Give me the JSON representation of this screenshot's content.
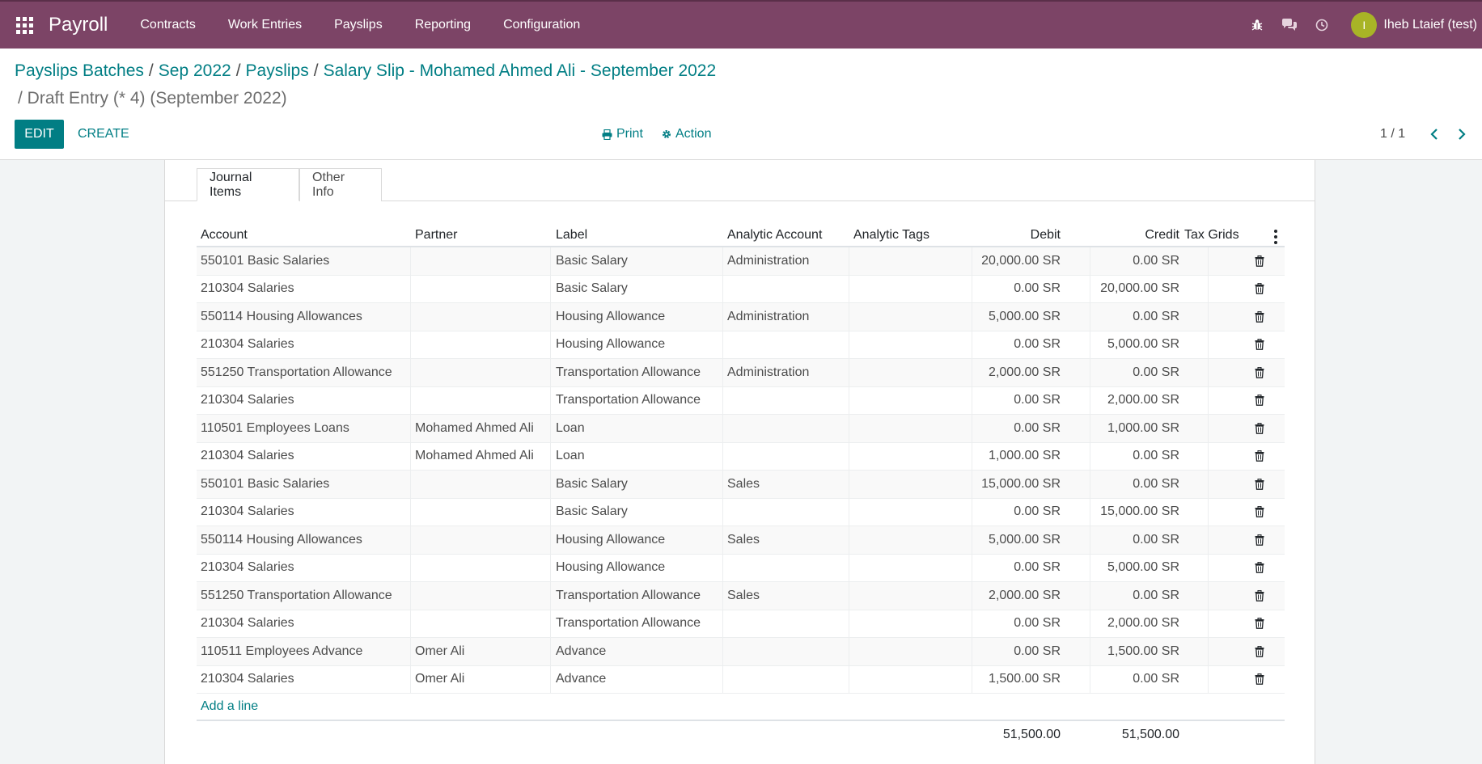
{
  "navbar": {
    "brand": "Payroll",
    "menu": [
      "Contracts",
      "Work Entries",
      "Payslips",
      "Reporting",
      "Configuration"
    ],
    "user_initial": "I",
    "username": "Iheb Ltaief (test)"
  },
  "breadcrumb": {
    "items": [
      "Payslips Batches",
      "Sep 2022",
      "Payslips",
      "Salary Slip - Mohamed Ahmed Ali - September 2022"
    ],
    "current": "/ Draft Entry (* 4) (September 2022)"
  },
  "buttons": {
    "edit": "EDIT",
    "create": "CREATE",
    "print": "Print",
    "action": "Action"
  },
  "pager": {
    "value": "1 / 1"
  },
  "tabs": [
    "Journal Items",
    "Other Info"
  ],
  "table": {
    "headers": {
      "account": "Account",
      "partner": "Partner",
      "label": "Label",
      "analytic": "Analytic Account",
      "tags": "Analytic Tags",
      "debit": "Debit",
      "credit": "Credit",
      "tax": "Tax Grids"
    },
    "rows": [
      {
        "account": "550101 Basic Salaries",
        "partner": "",
        "label": "Basic Salary",
        "analytic": "Administration",
        "debit": "20,000.00 SR",
        "credit": "0.00 SR"
      },
      {
        "account": "210304 Salaries",
        "partner": "",
        "label": "Basic Salary",
        "analytic": "",
        "debit": "0.00 SR",
        "credit": "20,000.00 SR"
      },
      {
        "account": "550114 Housing Allowances",
        "partner": "",
        "label": "Housing Allowance",
        "analytic": "Administration",
        "debit": "5,000.00 SR",
        "credit": "0.00 SR"
      },
      {
        "account": "210304 Salaries",
        "partner": "",
        "label": "Housing Allowance",
        "analytic": "",
        "debit": "0.00 SR",
        "credit": "5,000.00 SR"
      },
      {
        "account": "551250 Transportation Allowance",
        "partner": "",
        "label": "Transportation Allowance",
        "analytic": "Administration",
        "debit": "2,000.00 SR",
        "credit": "0.00 SR"
      },
      {
        "account": "210304 Salaries",
        "partner": "",
        "label": "Transportation Allowance",
        "analytic": "",
        "debit": "0.00 SR",
        "credit": "2,000.00 SR"
      },
      {
        "account": "110501 Employees Loans",
        "partner": "Mohamed Ahmed Ali",
        "label": "Loan",
        "analytic": "",
        "debit": "0.00 SR",
        "credit": "1,000.00 SR"
      },
      {
        "account": "210304 Salaries",
        "partner": "Mohamed Ahmed Ali",
        "label": "Loan",
        "analytic": "",
        "debit": "1,000.00 SR",
        "credit": "0.00 SR"
      },
      {
        "account": "550101 Basic Salaries",
        "partner": "",
        "label": "Basic Salary",
        "analytic": "Sales",
        "debit": "15,000.00 SR",
        "credit": "0.00 SR"
      },
      {
        "account": "210304 Salaries",
        "partner": "",
        "label": "Basic Salary",
        "analytic": "",
        "debit": "0.00 SR",
        "credit": "15,000.00 SR"
      },
      {
        "account": "550114 Housing Allowances",
        "partner": "",
        "label": "Housing Allowance",
        "analytic": "Sales",
        "debit": "5,000.00 SR",
        "credit": "0.00 SR"
      },
      {
        "account": "210304 Salaries",
        "partner": "",
        "label": "Housing Allowance",
        "analytic": "",
        "debit": "0.00 SR",
        "credit": "5,000.00 SR"
      },
      {
        "account": "551250 Transportation Allowance",
        "partner": "",
        "label": "Transportation Allowance",
        "analytic": "Sales",
        "debit": "2,000.00 SR",
        "credit": "0.00 SR"
      },
      {
        "account": "210304 Salaries",
        "partner": "",
        "label": "Transportation Allowance",
        "analytic": "",
        "debit": "0.00 SR",
        "credit": "2,000.00 SR"
      },
      {
        "account": "110511 Employees Advance",
        "partner": "Omer Ali",
        "label": "Advance",
        "analytic": "",
        "debit": "0.00 SR",
        "credit": "1,500.00 SR"
      },
      {
        "account": "210304 Salaries",
        "partner": "Omer Ali",
        "label": "Advance",
        "analytic": "",
        "debit": "1,500.00 SR",
        "credit": "0.00 SR"
      }
    ],
    "add_line": "Add a line",
    "total_debit": "51,500.00",
    "total_credit": "51,500.00"
  }
}
